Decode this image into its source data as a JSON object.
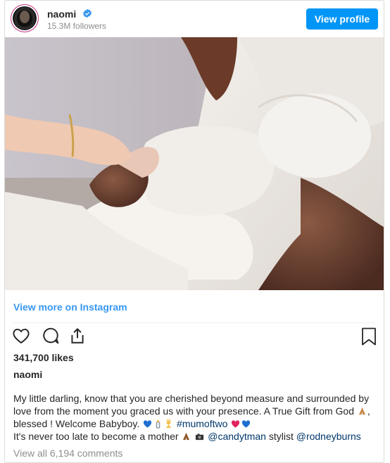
{
  "header": {
    "username": "naomi",
    "followers": "15.3M followers",
    "view_profile": "View profile"
  },
  "media": {
    "view_more": "View more on Instagram"
  },
  "actions": {
    "icons": [
      "heart-icon",
      "comment-icon",
      "share-icon",
      "bookmark-icon"
    ]
  },
  "stats": {
    "likes": "341,700 likes"
  },
  "caption": {
    "owner": "naomi",
    "text_1": "My little darling, know that you are cherished beyond measure and surrounded by love from the moment you graced us with your presence. A True Gift from God",
    "text_2": "blessed ! Welcome Babyboy.",
    "hashtag": "#mumoftwo",
    "text_3": "It's never too late to become a mother",
    "mention_1": "@candytman",
    "text_4": "stylist",
    "mention_2": "@rodneyburns"
  },
  "comments": {
    "view_all": "View all 6,194 comments"
  },
  "colors": {
    "accent": "#0095f6",
    "link": "#3897f0",
    "hashtag": "#00376b",
    "verified": "#3897f0"
  }
}
